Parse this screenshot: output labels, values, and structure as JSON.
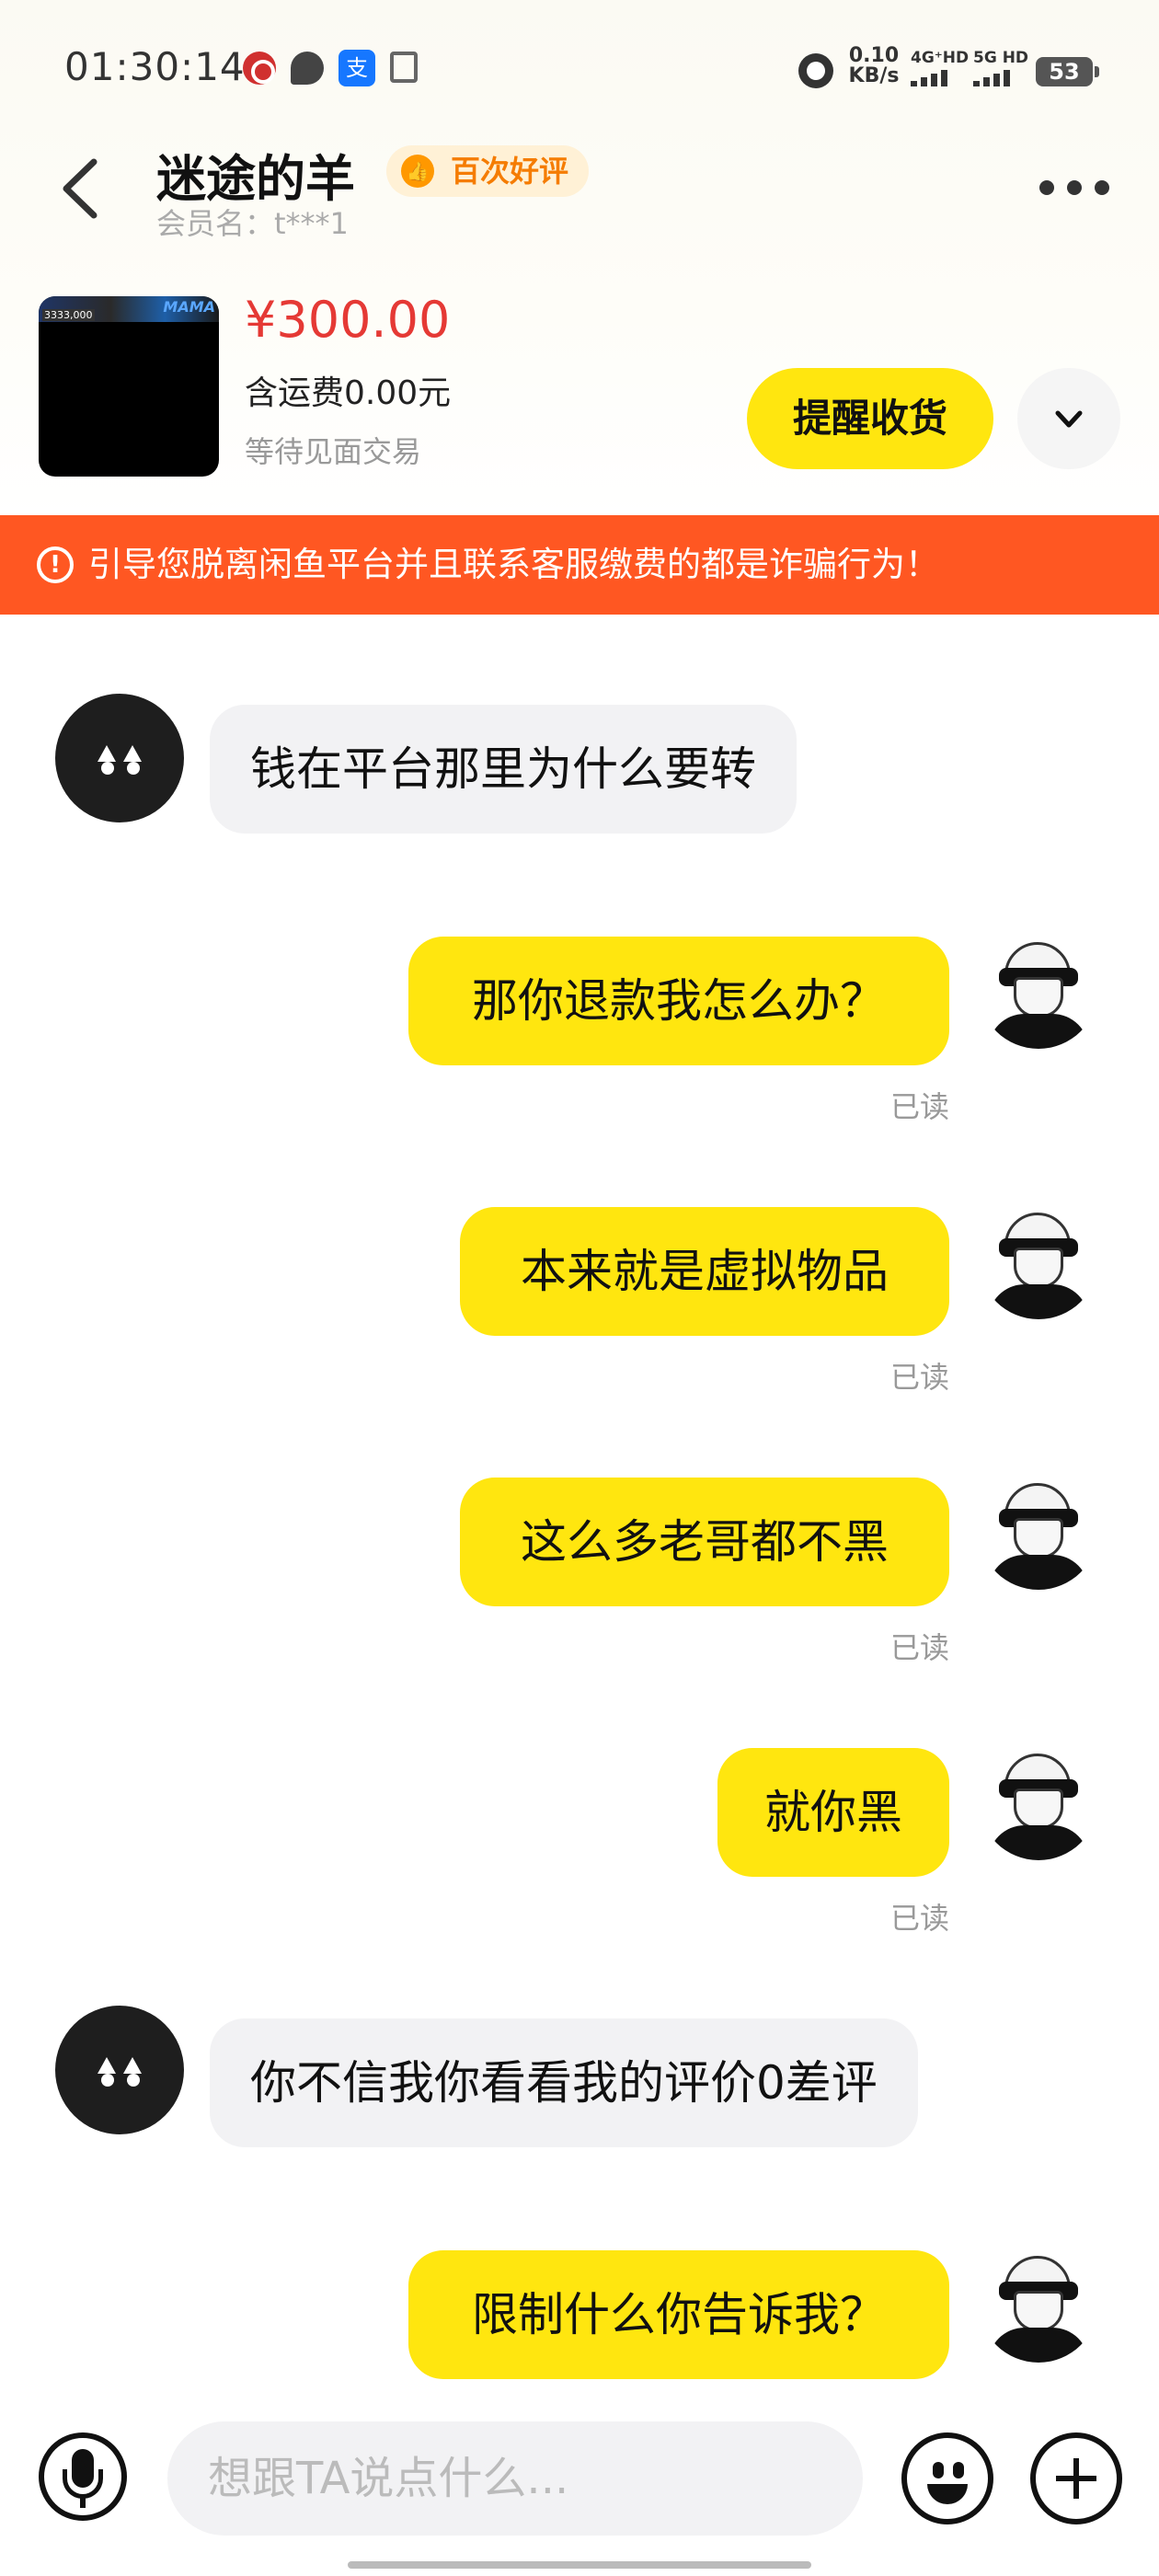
{
  "status_bar": {
    "time": "01:30:14",
    "net_speed_value": "0.10",
    "net_speed_unit": "KB/s",
    "signal_1": "4G⁺HD",
    "signal_2": "5G HD",
    "battery": "53",
    "icons": [
      "bank-icon",
      "chat-icon",
      "alipay-icon",
      "clipboard-icon",
      "alarm-icon"
    ]
  },
  "header": {
    "seller_name": "迷途的羊",
    "rating_badge": "百次好评",
    "member_label": "会员名：t***1"
  },
  "product": {
    "thumb_tag": "MAMA",
    "thumb_code": "3333,000",
    "price": "¥300.00",
    "shipping": "含运费0.00元",
    "status": "等待见面交易",
    "remind_button": "提醒收货"
  },
  "warning": {
    "text": "引导您脱离闲鱼平台并且联系客服缴费的都是诈骗行为！"
  },
  "messages": [
    {
      "side": "left",
      "text": "钱在平台那里为什么要转"
    },
    {
      "side": "right",
      "text": "那你退款我怎么办？",
      "read": "已读"
    },
    {
      "side": "right",
      "text": "本来就是虚拟物品",
      "read": "已读"
    },
    {
      "side": "right",
      "text": "这么多老哥都不黑",
      "read": "已读"
    },
    {
      "side": "right",
      "text": "就你黑",
      "read": "已读"
    },
    {
      "side": "left",
      "text": "你不信我你看看我的评价0差评"
    },
    {
      "side": "right",
      "text": "限制什么你告诉我？"
    }
  ],
  "input_bar": {
    "placeholder": "想跟TA说点什么..."
  },
  "colors": {
    "accent_yellow": "#ffe60f",
    "price_red": "#e53935",
    "warning_orange": "#ff5722",
    "badge_orange": "#f57c00"
  }
}
